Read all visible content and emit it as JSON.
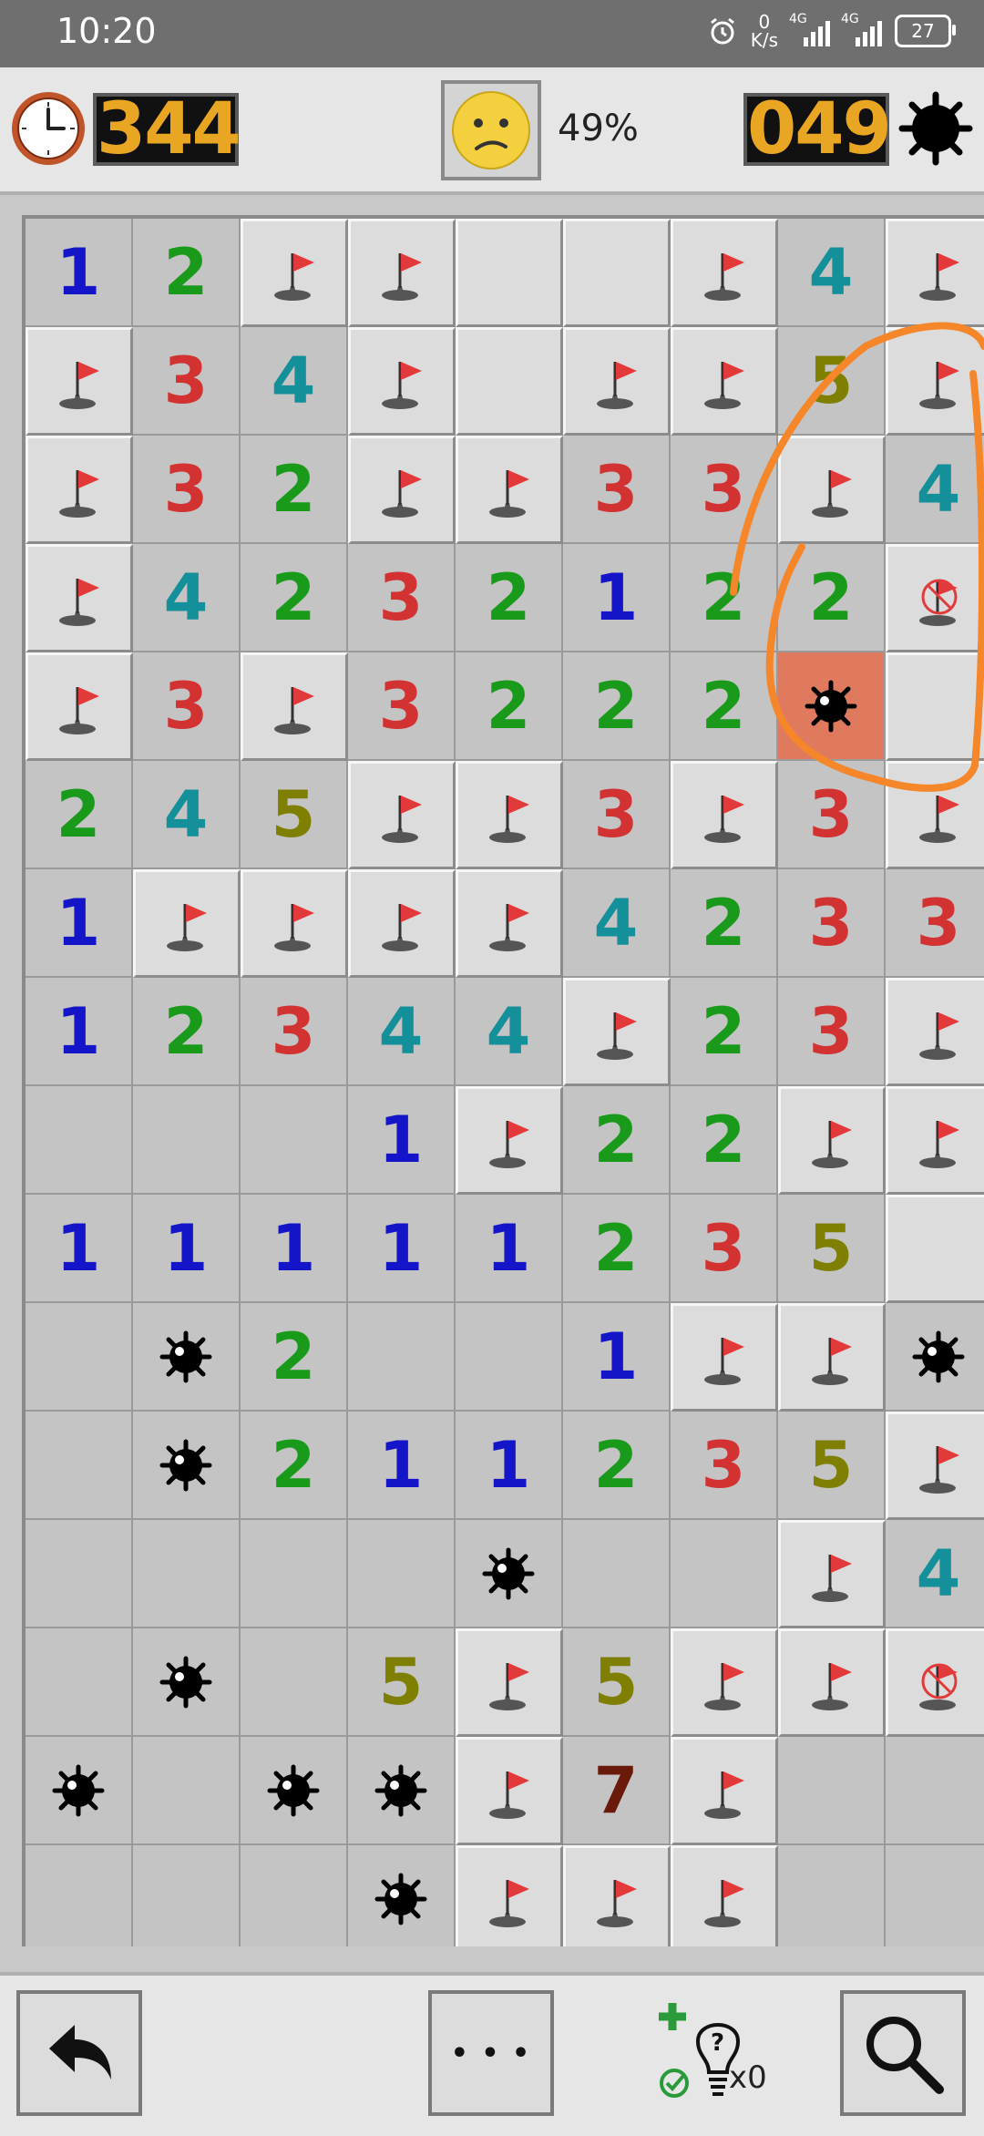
{
  "status_bar": {
    "time": "10:20",
    "speed_value": "0",
    "speed_unit": "K/s",
    "signal_1": "4G",
    "signal_2": "4G",
    "battery": "27"
  },
  "header": {
    "timer": "344",
    "progress": "49%",
    "mines_left": "049",
    "face": "worried"
  },
  "board": {
    "columns": 9,
    "legend": {
      "F": "flag",
      "M": "mine",
      "X": "exploded-mine",
      "W": "wrong-flag",
      "O": "empty-open",
      "C": "closed",
      "1-8": "number"
    },
    "rows": [
      [
        "1",
        "2",
        "F",
        "F",
        "C",
        "C",
        "F",
        "4",
        "F"
      ],
      [
        "F",
        "3",
        "4",
        "F",
        "C",
        "F",
        "F",
        "5",
        "F"
      ],
      [
        "F",
        "3",
        "2",
        "F",
        "F",
        "3",
        "3",
        "F",
        "4"
      ],
      [
        "F",
        "4",
        "2",
        "3",
        "2",
        "1",
        "2",
        "2",
        "W"
      ],
      [
        "F",
        "3",
        "F",
        "3",
        "2",
        "2",
        "2",
        "X",
        "C"
      ],
      [
        "2",
        "4",
        "5",
        "F",
        "F",
        "3",
        "F",
        "3",
        "F"
      ],
      [
        "1",
        "F",
        "F",
        "F",
        "F",
        "4",
        "2",
        "3",
        "3"
      ],
      [
        "1",
        "2",
        "3",
        "4",
        "4",
        "F",
        "2",
        "3",
        "F"
      ],
      [
        "O",
        "O",
        "O",
        "1",
        "F",
        "2",
        "2",
        "F",
        "F"
      ],
      [
        "1",
        "1",
        "1",
        "1",
        "1",
        "2",
        "3",
        "5",
        "C"
      ],
      [
        "O",
        "M",
        "2",
        "O",
        "O",
        "1",
        "F",
        "F",
        "M"
      ],
      [
        "O",
        "M",
        "2",
        "1",
        "1",
        "2",
        "3",
        "5",
        "F"
      ],
      [
        "O",
        "O",
        "O",
        "O",
        "M",
        "O",
        "O",
        "F",
        "4"
      ],
      [
        "O",
        "M",
        "O",
        "5",
        "F",
        "5",
        "F",
        "F",
        "W"
      ],
      [
        "M",
        "O",
        "M",
        "M",
        "F",
        "7",
        "F",
        "O",
        "O"
      ],
      [
        "O",
        "O",
        "O",
        "M",
        "F",
        "F",
        "F",
        "O",
        "O"
      ]
    ]
  },
  "toolbar": {
    "undo_icon": "undo-arrow-icon",
    "menu_label": "• • •",
    "hint_count": "x0",
    "zoom_icon": "magnifier-icon"
  },
  "colors": {
    "n1": "#1414c8",
    "n2": "#1a9a1a",
    "n3": "#d23232",
    "n4": "#14909a",
    "n5": "#808000",
    "n7": "#6a1a0a",
    "counter": "#e8a623",
    "annotation": "#f5862a"
  }
}
